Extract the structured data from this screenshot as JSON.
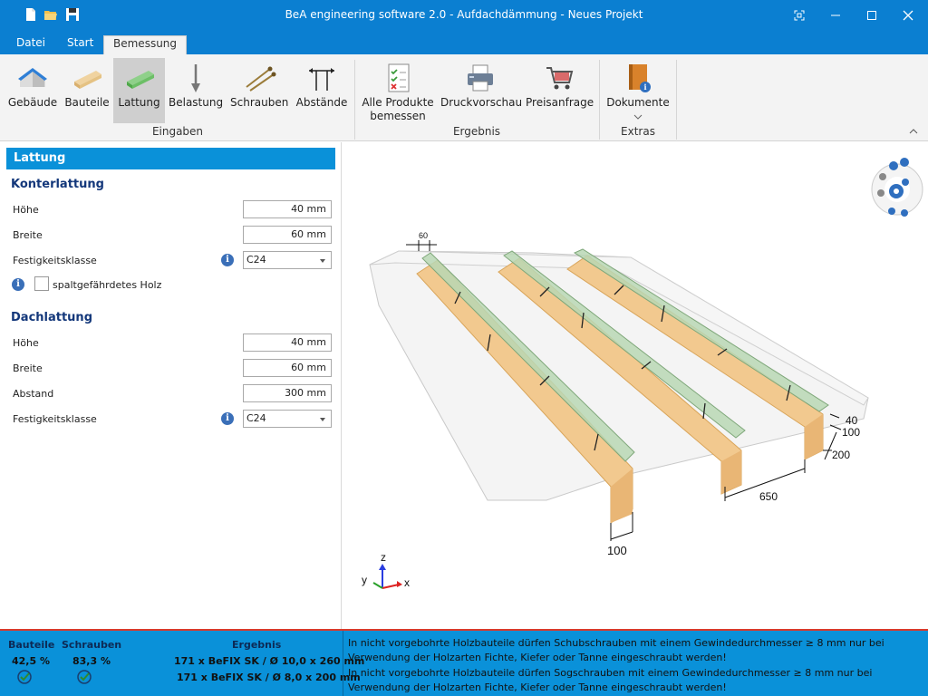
{
  "window": {
    "title": "BeA engineering software 2.0 - Aufdachdämmung - Neues Projekt"
  },
  "menu_tabs": [
    "Datei",
    "Start",
    "Bemessung"
  ],
  "ribbon": {
    "groups": [
      {
        "label": "Eingaben",
        "items": [
          "Gebäude",
          "Bauteile",
          "Lattung",
          "Belastung",
          "Schrauben",
          "Abstände"
        ]
      },
      {
        "label": "Ergebnis",
        "items": [
          "Alle Produkte\nbemessen",
          "Druckvorschau",
          "Preisanfrage"
        ]
      },
      {
        "label": "Extras",
        "items": [
          "Dokumente"
        ]
      }
    ],
    "selected": "Lattung"
  },
  "panel": {
    "title": "Lattung",
    "konterlattung": {
      "heading": "Konterlattung",
      "hoehe_label": "Höhe",
      "hoehe": "40 mm",
      "breite_label": "Breite",
      "breite": "60 mm",
      "festigkeit_label": "Festigkeitsklasse",
      "festigkeit": "C24",
      "checkbox_label": "spaltgefährdetes Holz"
    },
    "dachlattung": {
      "heading": "Dachlattung",
      "hoehe_label": "Höhe",
      "hoehe": "40 mm",
      "breite_label": "Breite",
      "breite": "60 mm",
      "abstand_label": "Abstand",
      "abstand": "300 mm",
      "festigkeit_label": "Festigkeitsklasse",
      "festigkeit": "C24"
    }
  },
  "view": {
    "dimensions": {
      "top_width": "60",
      "d40": "40",
      "d100_right": "100",
      "d200": "200",
      "d650": "650",
      "d100_bottom": "100"
    },
    "axes": {
      "z": "z",
      "y": "y",
      "x": "x"
    }
  },
  "status": {
    "bauteile_label": "Bauteile",
    "bauteile_value": "42,5 %",
    "schrauben_label": "Schrauben",
    "schrauben_value": "83,3 %",
    "ergebnis_label": "Ergebnis",
    "ergebnis_lines": [
      "171 x BeFIX SK / Ø 10,0 x 260 mm",
      "171 x BeFIX SK / Ø 8,0 x 200 mm"
    ],
    "messages": [
      "In nicht vorgebohrte Holzbauteile dürfen Schubschrauben mit einem Gewindedurchmesser ≥ 8 mm nur bei Verwendung der Holzarten Fichte, Kiefer oder Tanne eingeschraubt werden!",
      "In nicht vorgebohrte Holzbauteile dürfen Sogschrauben mit einem Gewindedurchmesser ≥ 8 mm nur bei Verwendung der Holzarten Fichte, Kiefer oder Tanne eingeschraubt werden!"
    ]
  },
  "colors": {
    "accent": "#0a91d9",
    "titlebar": "#0b7fd1",
    "warning_line": "#d93a2b"
  }
}
